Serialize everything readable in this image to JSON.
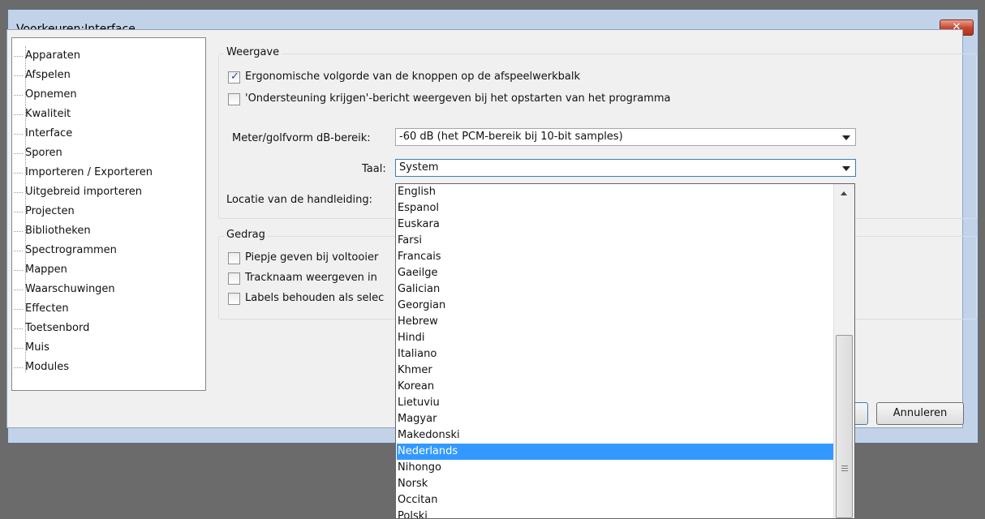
{
  "window": {
    "title": "Voorkeuren:Interface",
    "close_label": "✕"
  },
  "sidebar": {
    "items": [
      {
        "label": "Apparaten"
      },
      {
        "label": "Afspelen"
      },
      {
        "label": "Opnemen"
      },
      {
        "label": "Kwaliteit"
      },
      {
        "label": "Interface"
      },
      {
        "label": "Sporen"
      },
      {
        "label": "Importeren / Exporteren"
      },
      {
        "label": "Uitgebreid importeren"
      },
      {
        "label": "Projecten"
      },
      {
        "label": "Bibliotheken"
      },
      {
        "label": "Spectrogrammen"
      },
      {
        "label": "Mappen"
      },
      {
        "label": "Waarschuwingen"
      },
      {
        "label": "Effecten"
      },
      {
        "label": "Toetsenbord"
      },
      {
        "label": "Muis"
      },
      {
        "label": "Modules"
      }
    ]
  },
  "weergave": {
    "title": "Weergave",
    "checkbox1": {
      "label": "Ergonomische volgorde van de knoppen op de afspeelwerkbalk",
      "checked": true
    },
    "checkbox2": {
      "label": "'Ondersteuning krijgen'-bericht weergeven bij het opstarten van het programma",
      "checked": false
    },
    "meter_label": "Meter/golfvorm dB-bereik:",
    "meter_value": "-60 dB (het PCM-bereik bij 10-bit samples)",
    "taal_label": "Taal:",
    "taal_value": "System",
    "locatie_label": "Locatie van de handleiding:"
  },
  "gedrag": {
    "title": "Gedrag",
    "checkbox1": {
      "label": "Piepje geven bij voltooier",
      "checked": false
    },
    "checkbox2": {
      "label": "Tracknaam weergeven in",
      "checked": false
    },
    "checkbox3": {
      "label": "Labels behouden als selec",
      "checked": false
    }
  },
  "dropdown": {
    "items": [
      {
        "label": "English"
      },
      {
        "label": "Espanol"
      },
      {
        "label": "Euskara"
      },
      {
        "label": "Farsi"
      },
      {
        "label": "Francais"
      },
      {
        "label": "Gaeilge"
      },
      {
        "label": "Galician"
      },
      {
        "label": "Georgian"
      },
      {
        "label": "Hebrew"
      },
      {
        "label": "Hindi"
      },
      {
        "label": "Italiano"
      },
      {
        "label": "Khmer"
      },
      {
        "label": "Korean"
      },
      {
        "label": "Lietuviu"
      },
      {
        "label": "Magyar"
      },
      {
        "label": "Makedonski"
      },
      {
        "label": "Nederlands",
        "selected": true
      },
      {
        "label": "Nihongo"
      },
      {
        "label": "Norsk"
      },
      {
        "label": "Occitan"
      },
      {
        "label": "Polski"
      }
    ]
  },
  "buttons": {
    "cancel_label": "Annuleren"
  }
}
